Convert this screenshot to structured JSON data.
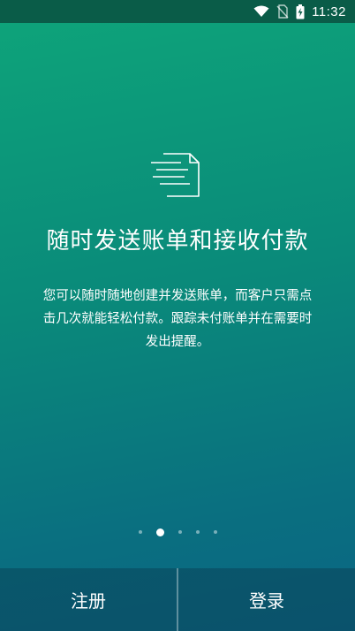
{
  "status_bar": {
    "time": "11:32",
    "icons": [
      "wifi-icon",
      "no-sim-icon",
      "battery-charging-icon"
    ]
  },
  "onboarding": {
    "icon": "invoice-send-icon",
    "title": "随时发送账单和接收付款",
    "description": "您可以随时随地创建并发送账单，而客户只需点击几次就能轻松付款。跟踪未付账单并在需要时发出提醒。",
    "pages_total": 5,
    "page_current": 2
  },
  "actions": {
    "register_label": "注册",
    "login_label": "登录"
  },
  "colors": {
    "gradient_top": "#0ea57a",
    "gradient_bottom": "#0b6583",
    "status_bar_bg": "#0a5c48",
    "text": "#ffffff"
  }
}
